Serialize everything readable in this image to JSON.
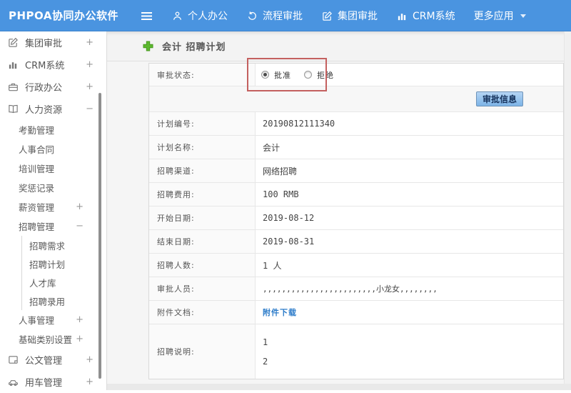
{
  "header": {
    "logo": "PHPOA协同办公软件",
    "nav": [
      {
        "label": "个人办公"
      },
      {
        "label": "流程审批"
      },
      {
        "label": "集团审批"
      },
      {
        "label": "CRM系统"
      },
      {
        "label": "更多应用"
      }
    ]
  },
  "sidebar": {
    "items": [
      {
        "label": "集团审批",
        "toggle": "+"
      },
      {
        "label": "CRM系统",
        "toggle": "+"
      },
      {
        "label": "行政办公",
        "toggle": "+"
      },
      {
        "label": "人力资源",
        "toggle": "−"
      },
      {
        "label": "考勤管理",
        "toggle": ""
      },
      {
        "label": "人事合同",
        "toggle": ""
      },
      {
        "label": "培训管理",
        "toggle": ""
      },
      {
        "label": "奖惩记录",
        "toggle": ""
      },
      {
        "label": "薪资管理",
        "toggle": "+"
      },
      {
        "label": "招聘管理",
        "toggle": "−"
      },
      {
        "label": "招聘需求",
        "toggle": ""
      },
      {
        "label": "招聘计划",
        "toggle": ""
      },
      {
        "label": "人才库",
        "toggle": ""
      },
      {
        "label": "招聘录用",
        "toggle": ""
      },
      {
        "label": "人事管理",
        "toggle": "+"
      },
      {
        "label": "基础类别设置",
        "toggle": "+"
      },
      {
        "label": "公文管理",
        "toggle": "+"
      },
      {
        "label": "用车管理",
        "toggle": "+"
      }
    ]
  },
  "main": {
    "page_title": "会计 招聘计划",
    "form": {
      "status_label": "审批状态:",
      "status_options": [
        {
          "label": "批准",
          "selected": true
        },
        {
          "label": "拒绝",
          "selected": false
        }
      ],
      "approval_info_button": "审批信息",
      "rows": [
        {
          "label": "计划编号:",
          "value": "20190812111340"
        },
        {
          "label": "计划名称:",
          "value": "会计"
        },
        {
          "label": "招聘渠道:",
          "value": "网络招聘"
        },
        {
          "label": "招聘费用:",
          "value": "100 RMB"
        },
        {
          "label": "开始日期:",
          "value": "2019-08-12"
        },
        {
          "label": "结束日期:",
          "value": "2019-08-31"
        },
        {
          "label": "招聘人数:",
          "value": "1 人"
        },
        {
          "label": "审批人员:",
          "value": ",,,,,,,,,,,,,,,,,,,,,,,,小龙女,,,,,,,,"
        },
        {
          "label": "附件文档:",
          "link": "附件下载"
        },
        {
          "label": "招聘说明:",
          "line1": "1",
          "line2": "2"
        }
      ]
    }
  },
  "colors": {
    "header_blue": "#4a94e0",
    "link_blue": "#2b7bc9",
    "annotation_red": "#c4605f",
    "add_icon_green": "#5cb82e",
    "button_blue": "#7db4e7"
  }
}
